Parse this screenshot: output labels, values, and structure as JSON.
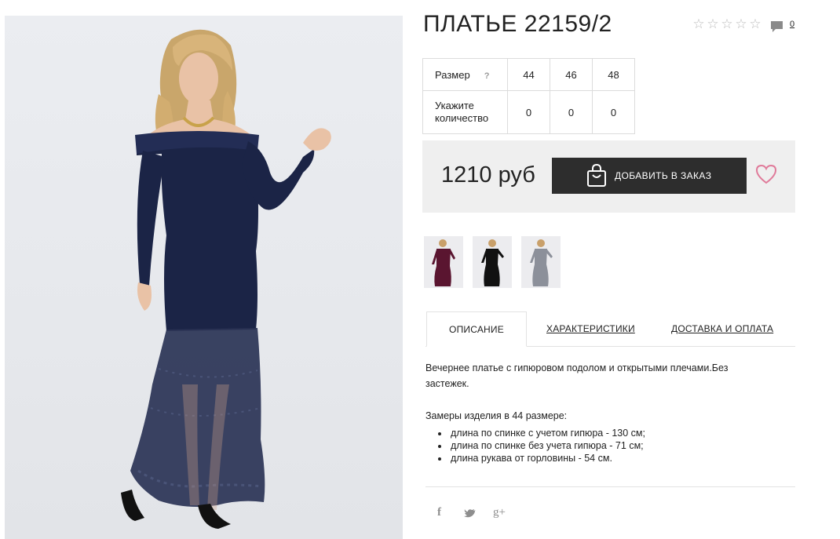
{
  "product": {
    "title": "ПЛАТЬЕ 22159/2",
    "comments_count": "0",
    "rating_icon": "star-outline-icon",
    "rating_value": 0
  },
  "size_table": {
    "size_label": "Размер",
    "help_mark": "?",
    "sizes": [
      "44",
      "46",
      "48"
    ],
    "quantity_label": "Укажите количество",
    "quantities": [
      "0",
      "0",
      "0"
    ]
  },
  "purchase": {
    "price": "1210 руб",
    "add_button_label": "ДОБАВИТЬ В ЗАКАЗ",
    "wishlist_color": "#e07b9a"
  },
  "thumbnails": [
    {
      "color": "#5a1530",
      "icon": "dress-burgundy-thumbnail"
    },
    {
      "color": "#111111",
      "icon": "dress-black-thumbnail"
    },
    {
      "color": "#8c909a",
      "icon": "dress-grey-thumbnail"
    }
  ],
  "tabs": [
    {
      "label": "ОПИСАНИЕ",
      "active": true
    },
    {
      "label": "ХАРАКТЕРИСТИКИ",
      "active": false
    },
    {
      "label": "ДОСТАВКА И ОПЛАТА",
      "active": false
    }
  ],
  "description": {
    "text": "Вечернее платье с гипюровом подолом и открытыми плечами.Без застежек.",
    "measurements_title": "Замеры изделия в 44 размере:",
    "measurements": [
      "длина по спинке с учетом гипюра - 130 см;",
      "длина по спинке без учета гипюра - 71 см;",
      "длина рукава от горловины - 54 см."
    ]
  },
  "social": {
    "facebook": "f",
    "twitter": "twitter-bird-icon",
    "googleplus": "g+"
  },
  "colors": {
    "dress_main": "#1b2446",
    "button_bg": "#2d2d2d",
    "price_box_bg": "#efefef"
  }
}
